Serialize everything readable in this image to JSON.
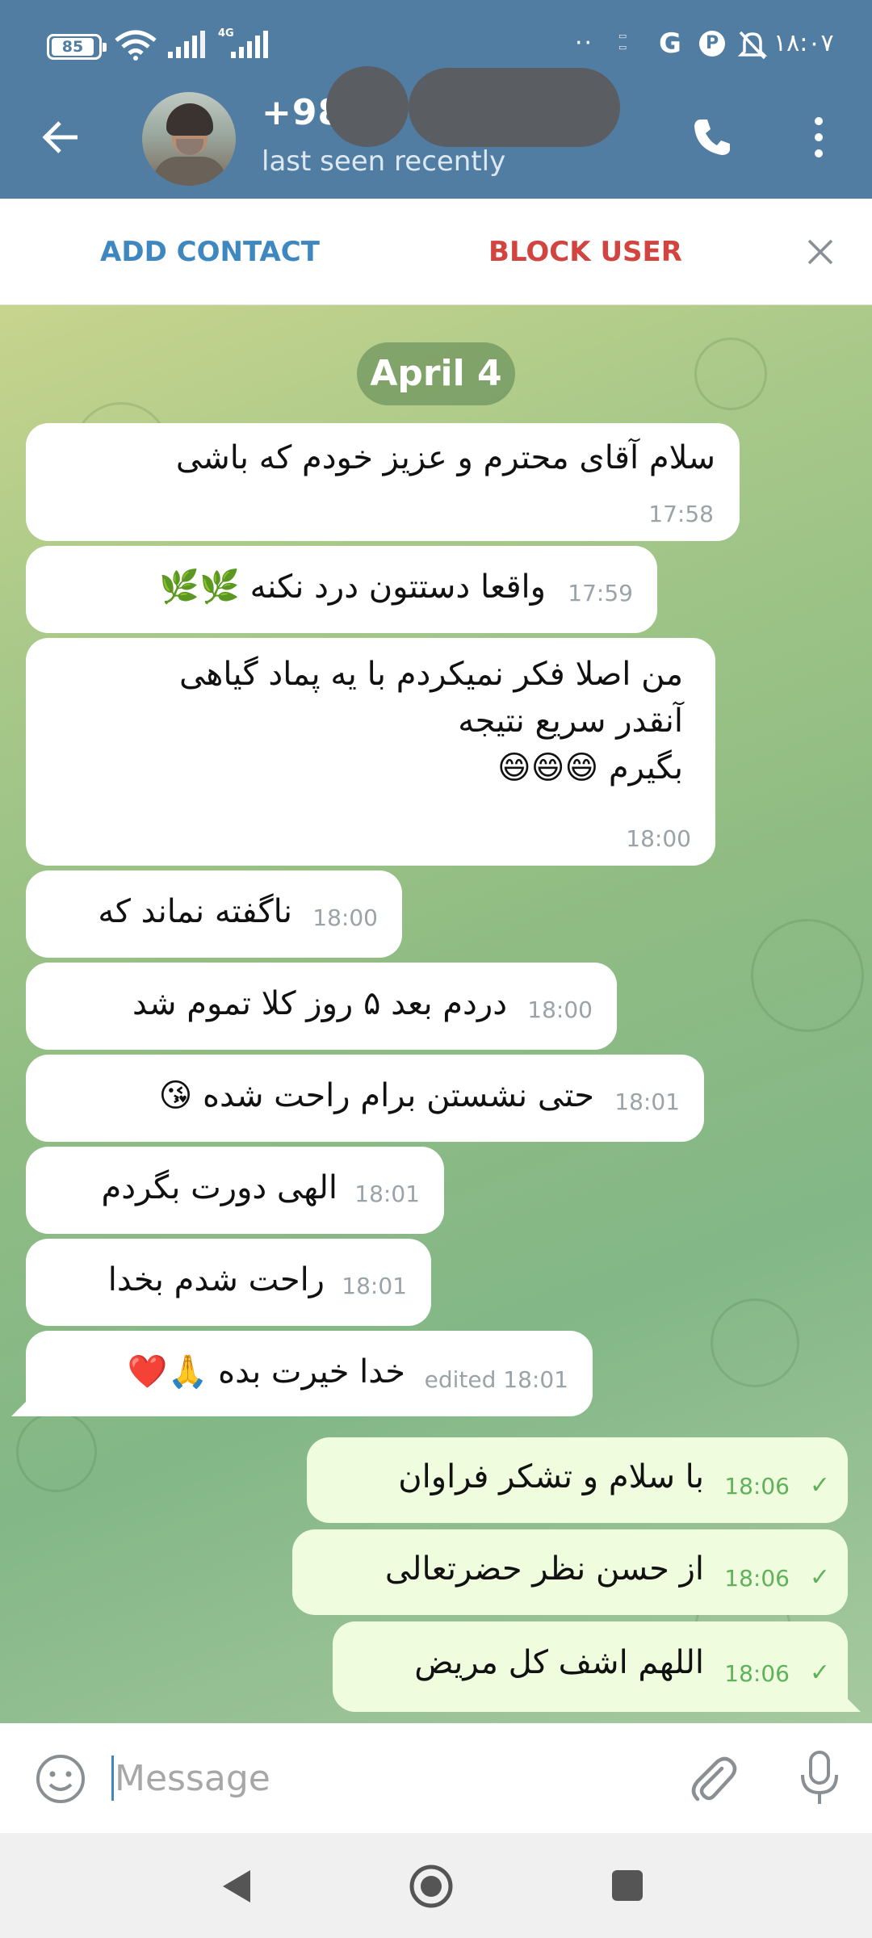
{
  "status_bar": {
    "battery": "85",
    "network": "4G",
    "time": "۱۸:۰۷"
  },
  "header": {
    "contact_name": "+98",
    "status": "last seen recently"
  },
  "action_bar": {
    "add_contact": "ADD CONTACT",
    "block_user": "BLOCK USER"
  },
  "chat": {
    "date": "April 4",
    "messages": [
      {
        "dir": "in",
        "text": "سلام آقای محترم و عزیز خودم که باشی",
        "time": "17:58"
      },
      {
        "dir": "in",
        "text": "واقعا دستتون درد نکنه 🌿🌿",
        "time": "17:59"
      },
      {
        "dir": "in",
        "lines": [
          "من اصلا فکر نمیکردم با یه پماد گیاهی",
          "آنقدر سریع نتیجه",
          "بگیرم 😄😄😄"
        ],
        "time": "18:00"
      },
      {
        "dir": "in",
        "text": "ناگفته نماند که",
        "time": "18:00"
      },
      {
        "dir": "in",
        "text": "دردم بعد ۵ روز کلا تموم شد",
        "time": "18:00"
      },
      {
        "dir": "in",
        "text": "حتی نشستن برام راحت شده 😘",
        "time": "18:01"
      },
      {
        "dir": "in",
        "text": "الهی دورت بگردم",
        "time": "18:01"
      },
      {
        "dir": "in",
        "text": "راحت شدم بخدا",
        "time": "18:01"
      },
      {
        "dir": "in",
        "text": "خدا خیرت بده 🙏❤️",
        "time": "edited 18:01"
      },
      {
        "dir": "out",
        "text": "با سلام و تشکر فراوان",
        "time": "18:06",
        "status": "✓"
      },
      {
        "dir": "out",
        "text": "از حسن نظر حضرتعالی",
        "time": "18:06",
        "status": "✓"
      },
      {
        "dir": "out",
        "text": "اللهم اشف کل مریض",
        "time": "18:06",
        "status": "✓"
      }
    ]
  },
  "composer": {
    "placeholder": "Message"
  },
  "icons": {
    "back": "arrow-left-icon",
    "call": "phone-icon",
    "menu": "more-vert-icon",
    "close": "close-icon",
    "emoji": "smile-icon",
    "attach": "paperclip-icon",
    "mic": "mic-icon"
  },
  "colors": {
    "header": "#517DA2",
    "add_contact": "#3E88BF",
    "block_user": "#D2443F",
    "incoming_bubble": "#FFFFFF",
    "outgoing_bubble": "#EFFDDE",
    "read_check": "#5FB25A"
  }
}
